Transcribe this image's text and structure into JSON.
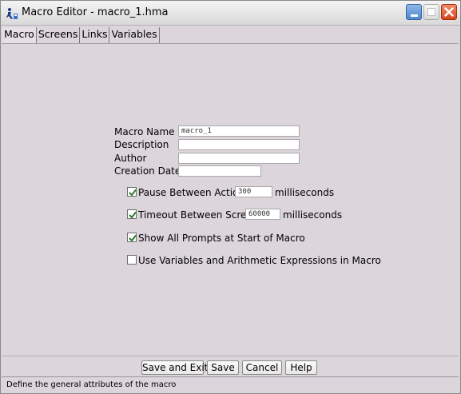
{
  "window": {
    "title": "Macro Editor - macro_1.hma"
  },
  "tabs": [
    {
      "label": "Macro",
      "active": true
    },
    {
      "label": "Screens",
      "active": false
    },
    {
      "label": "Links",
      "active": false
    },
    {
      "label": "Variables",
      "active": false
    }
  ],
  "form": {
    "macro_name": {
      "label": "Macro Name",
      "value": "macro_1"
    },
    "description": {
      "label": "Description",
      "value": ""
    },
    "author": {
      "label": "Author",
      "value": ""
    },
    "creation_date": {
      "label": "Creation Date",
      "value": ""
    }
  },
  "options": {
    "pause": {
      "label": "Pause Between Actions",
      "value": "300",
      "unit": "milliseconds",
      "checked": true
    },
    "timeout": {
      "label": "Timeout Between Screens",
      "value": "60000",
      "unit": "milliseconds",
      "checked": true
    },
    "show_prompts": {
      "label": "Show All Prompts at Start of Macro",
      "checked": true
    },
    "use_variables": {
      "label": "Use Variables and Arithmetic Expressions in Macro",
      "checked": false
    }
  },
  "buttons": {
    "save_exit": "Save and Exit",
    "save": "Save",
    "cancel": "Cancel",
    "help": "Help"
  },
  "status": {
    "text": "Define the general attributes of the macro"
  },
  "colors": {
    "background": "#dcd5dc",
    "check": "#2a7a2a",
    "close_button": "#d6451e",
    "minimize_button": "#4f86cf"
  },
  "icons": [
    "macro-app-icon",
    "minimize-icon",
    "maximize-icon",
    "close-icon",
    "checkmark-icon"
  ]
}
